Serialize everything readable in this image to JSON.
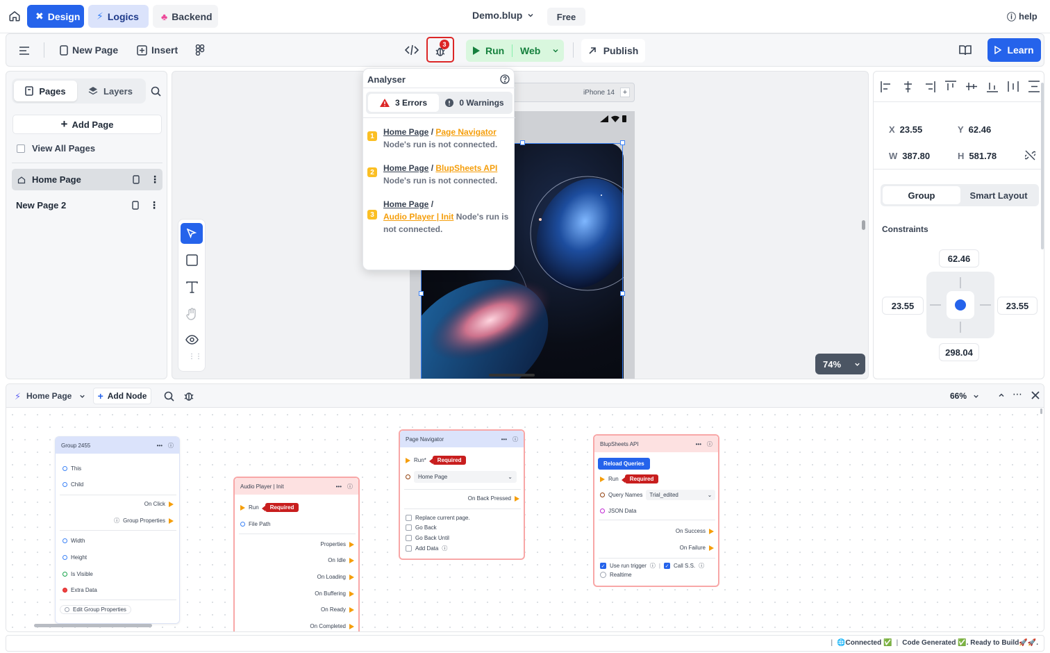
{
  "topbar": {
    "modes": [
      {
        "label": "Design"
      },
      {
        "label": "Logics"
      },
      {
        "label": "Backend"
      }
    ],
    "file_name": "Demo.blup",
    "plan": "Free",
    "help": "help"
  },
  "toolbar": {
    "new_page": "New Page",
    "insert": "Insert",
    "debug_count": "3",
    "run": "Run",
    "platform": "Web",
    "publish": "Publish",
    "learn": "Learn"
  },
  "left_panel": {
    "tabs": [
      {
        "label": "Pages"
      },
      {
        "label": "Layers"
      }
    ],
    "add_page": "Add Page",
    "view_all": "View All Pages",
    "pages": [
      {
        "label": "Home Page"
      },
      {
        "label": "New Page 2"
      }
    ]
  },
  "canvas": {
    "device": "iPhone 14",
    "zoom": "74%"
  },
  "analyser": {
    "title": "Analyser",
    "errors_tab": "3 Errors",
    "warnings_tab": "0 Warnings",
    "items": [
      {
        "num": "1",
        "page": "Home Page",
        "node": "Page Navigator",
        "message": "Node's run is not connected."
      },
      {
        "num": "2",
        "page": "Home Page",
        "node": "BlupSheets API",
        "message": "Node's run is not connected."
      },
      {
        "num": "3",
        "page": "Home Page",
        "node": "Audio Player | Init",
        "message": "Node's run is not connected."
      }
    ]
  },
  "right_panel": {
    "x_label": "X",
    "x": "23.55",
    "y_label": "Y",
    "y": "62.46",
    "w_label": "W",
    "w": "387.80",
    "h_label": "H",
    "h": "581.78",
    "layout_tabs": [
      {
        "label": "Group"
      },
      {
        "label": "Smart Layout"
      }
    ],
    "constraints_title": "Constraints",
    "c_top": "62.46",
    "c_left": "23.55",
    "c_right": "23.55",
    "c_bottom": "298.04"
  },
  "logic": {
    "page": "Home Page",
    "add_node": "Add Node",
    "zoom": "66%",
    "nodes": {
      "group": {
        "title": "Group 2455",
        "this": "This",
        "child": "Child",
        "on_click": "On Click",
        "group_props": "Group Properties",
        "width": "Width",
        "height": "Height",
        "visible": "Is Visible",
        "extra": "Extra Data",
        "edit": "Edit Group Properties"
      },
      "audio": {
        "title": "Audio Player | Init",
        "run": "Run",
        "required": "Required",
        "file_path": "File Path",
        "outputs": [
          "Properties",
          "On Idle",
          "On Loading",
          "On Buffering",
          "On Ready",
          "On Completed"
        ]
      },
      "nav": {
        "title": "Page Navigator",
        "run": "Run*",
        "required": "Required",
        "page": "Home Page",
        "on_back": "On Back Pressed",
        "options": [
          "Replace current page.",
          "Go Back",
          "Go Back Until",
          "Add Data"
        ]
      },
      "api": {
        "title": "BlupSheets API",
        "reload": "Reload Queries",
        "run": "Run",
        "required": "Required",
        "query_label": "Query Names",
        "query_value": "Trial_edited",
        "json": "JSON Data",
        "on_success": "On Success",
        "on_failure": "On Failure",
        "use_trigger": "Use run trigger",
        "call": "Call S.S.",
        "realtime": "Realtime"
      }
    }
  },
  "status": {
    "connected": "🌐Connected ✅",
    "generated": "Code Generated ✅. Ready to Build🚀🚀."
  },
  "colors": {
    "accent": "#2563eb",
    "run_green": "#16a34a",
    "error": "#dc2626",
    "warning": "#f59e0b"
  }
}
